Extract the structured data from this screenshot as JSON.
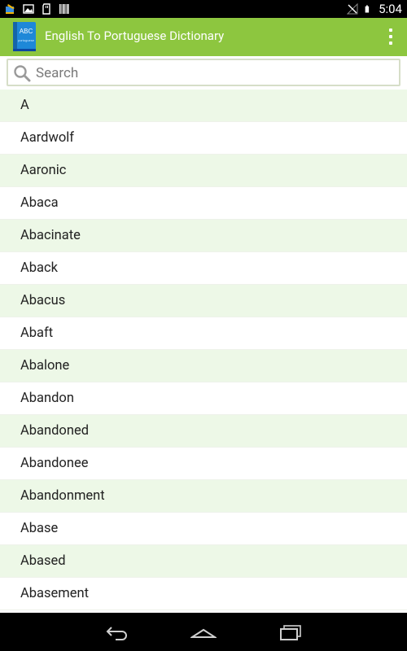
{
  "status_bar": {
    "time": "5:04",
    "left_icons": [
      "app-notification-icon",
      "image-icon",
      "sd-card-icon",
      "barcode-icon"
    ],
    "right_icons": [
      "no-signal-icon",
      "battery-icon"
    ]
  },
  "app_bar": {
    "title": "English To Portuguese Dictionary",
    "logo_text_top": "ABC",
    "logo_text_bottom": "portuguese",
    "menu_icon": "overflow-menu-icon"
  },
  "search": {
    "placeholder": "Search",
    "value": ""
  },
  "words": [
    "A",
    "Aardwolf",
    "Aaronic",
    "Abaca",
    "Abacinate",
    "Aback",
    "Abacus",
    "Abaft",
    "Abalone",
    "Abandon",
    "Abandoned",
    "Abandonee",
    "Abandonment",
    "Abase",
    "Abased",
    "Abasement"
  ],
  "colors": {
    "app_bar": "#8dc63f",
    "row_alt": "#edf8e7",
    "search_border": "#d6dec8"
  },
  "nav_bar": [
    "back-icon",
    "home-icon",
    "recent-apps-icon"
  ]
}
